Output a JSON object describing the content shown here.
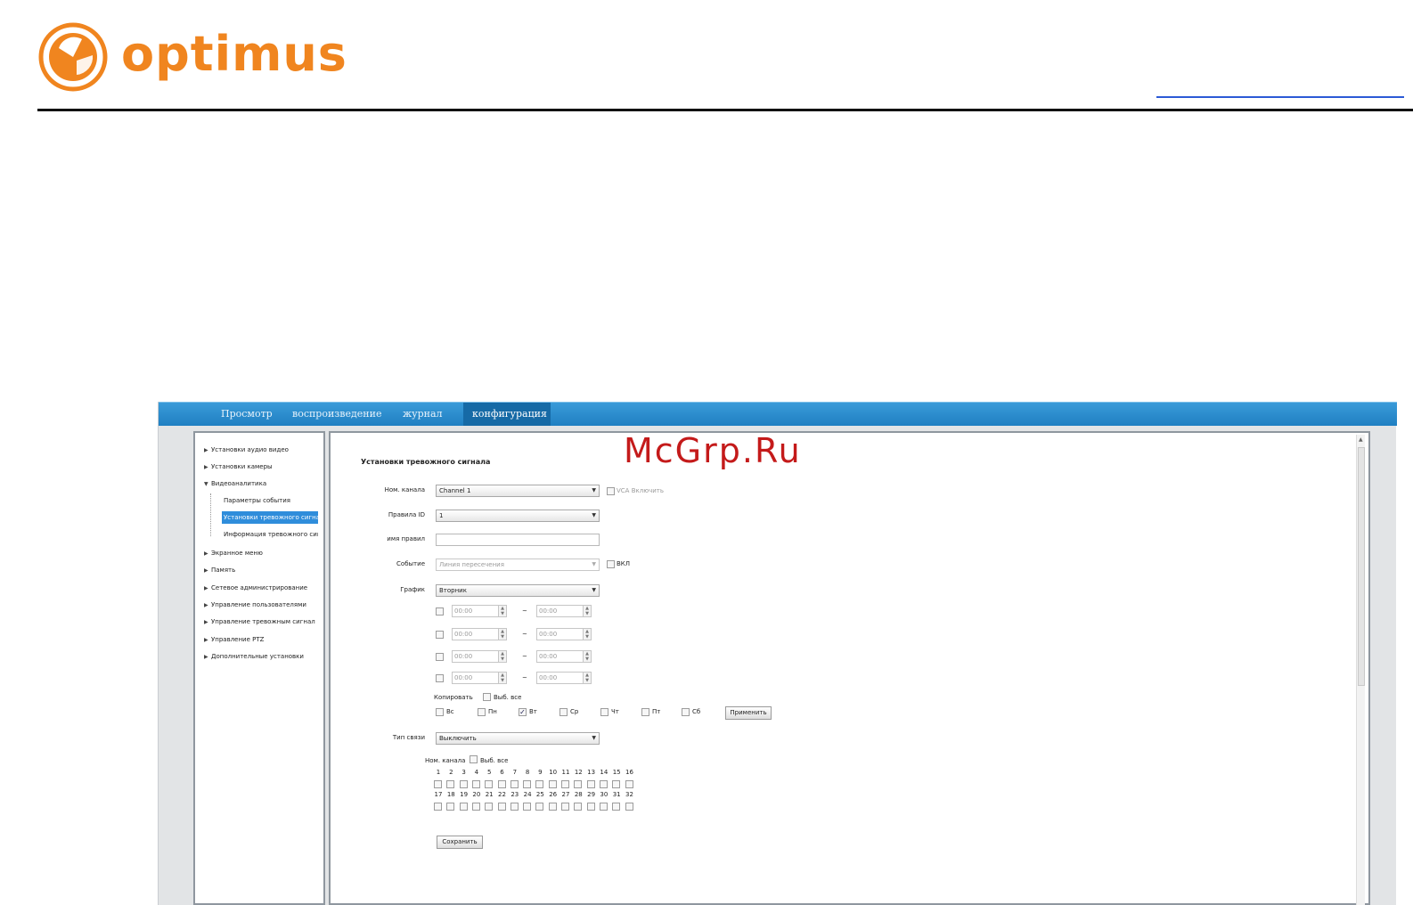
{
  "brand": {
    "name": "optimus",
    "color": "#f0851f"
  },
  "watermark": "McGrp.Ru",
  "nav": {
    "tabs": [
      {
        "label": "Просмотр"
      },
      {
        "label": "воспроизведение"
      },
      {
        "label": "журнал"
      },
      {
        "label": "конфигурация",
        "active": true
      }
    ]
  },
  "sidebar": {
    "items": [
      {
        "label": "Установки аудио видео"
      },
      {
        "label": "Установки камеры"
      },
      {
        "label": "Видеоаналитика",
        "expanded": true
      },
      {
        "label": "Экранное меню"
      },
      {
        "label": "Память"
      },
      {
        "label": "Сетевое администрирование"
      },
      {
        "label": "Управление пользователями"
      },
      {
        "label": "Управление тревожным сигнал"
      },
      {
        "label": "Управление PTZ"
      },
      {
        "label": "Дополнительные установки"
      }
    ],
    "subitems": [
      {
        "label": "Параметры события"
      },
      {
        "label": "Установки тревожного сигна",
        "selected": true
      },
      {
        "label": "Информация тревожного сиг"
      }
    ]
  },
  "form": {
    "title": "Установки тревожного сигнала",
    "channel_label": "Ном. канала",
    "channel_value": "Channel 1",
    "vca_label": "VCA Включить",
    "rule_id_label": "Правила ID",
    "rule_id_value": "1",
    "rule_name_label": "имя правил",
    "rule_name_value": "",
    "event_label": "Событие",
    "event_value": "Линия пересечения",
    "event_on_label": "ВКЛ",
    "schedule_label": "График",
    "schedule_value": "Вторник",
    "time_slots": [
      {
        "from": "00:00",
        "to": "00:00"
      },
      {
        "from": "00:00",
        "to": "00:00"
      },
      {
        "from": "00:00",
        "to": "00:00"
      },
      {
        "from": "00:00",
        "to": "00:00"
      }
    ],
    "tilde": "~",
    "copy_label": "Копировать",
    "select_all_label": "Выб. все",
    "days": [
      {
        "label": "Вс",
        "checked": false
      },
      {
        "label": "Пн",
        "checked": false
      },
      {
        "label": "Вт",
        "checked": true
      },
      {
        "label": "Ср",
        "checked": false
      },
      {
        "label": "Чт",
        "checked": false
      },
      {
        "label": "Пт",
        "checked": false
      },
      {
        "label": "Сб",
        "checked": false
      }
    ],
    "apply_label": "Применить",
    "link_type_label": "Тип связи",
    "link_type_value": "Выключить",
    "channel_no_label": "Ном. канала",
    "channel_select_all_label": "Выб. все",
    "channels_row1": [
      "1",
      "2",
      "3",
      "4",
      "5",
      "6",
      "7",
      "8",
      "9",
      "10",
      "11",
      "12",
      "13",
      "14",
      "15",
      "16"
    ],
    "channels_row2": [
      "17",
      "18",
      "19",
      "20",
      "21",
      "22",
      "23",
      "24",
      "25",
      "26",
      "27",
      "28",
      "29",
      "30",
      "31",
      "32"
    ],
    "save_label": "Сохранить"
  }
}
